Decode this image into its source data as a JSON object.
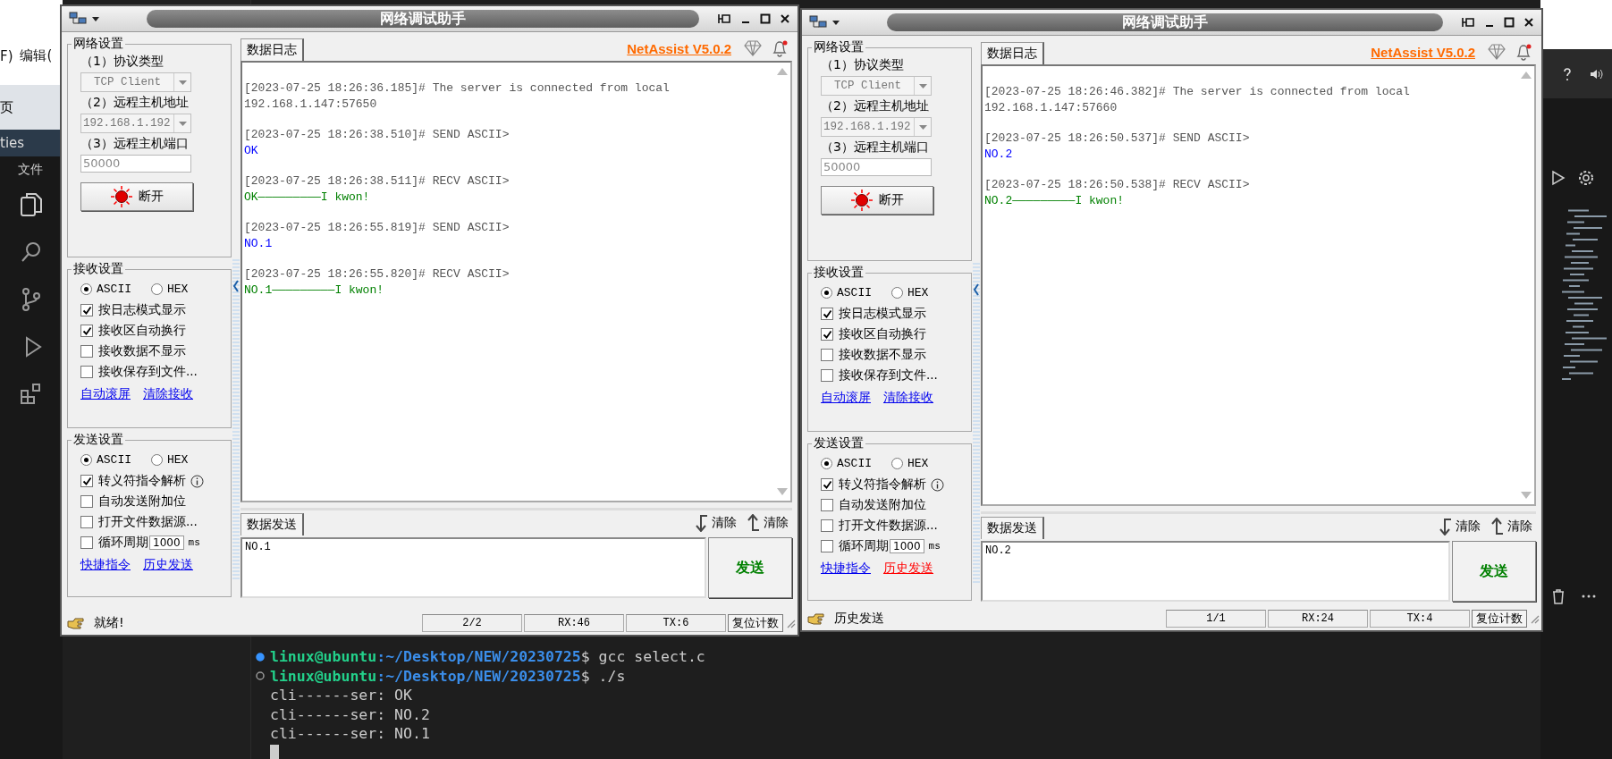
{
  "background": {
    "menu": [
      "F)",
      "编辑("
    ],
    "tab": "页",
    "explorer_title": "ties",
    "file_menu": "文件"
  },
  "windows": [
    {
      "title": "网络调试助手",
      "network_settings": {
        "title": "网络设置",
        "protocol_label": "（1）协议类型",
        "protocol": "TCP Client",
        "host_label": "（2）远程主机地址",
        "host": "192.168.1.192",
        "port_label": "（3）远程主机端口",
        "port": "50000",
        "connect_button": "断开",
        "connected": true
      },
      "receive_settings": {
        "title": "接收设置",
        "modes": [
          {
            "label": "ASCII",
            "selected": true
          },
          {
            "label": "HEX",
            "selected": false
          }
        ],
        "options": [
          {
            "kind": "plain",
            "label": "按日志模式显示",
            "checked": true
          },
          {
            "kind": "plain",
            "label": "接收区自动换行",
            "checked": true
          },
          {
            "kind": "plain",
            "label": "接收数据不显示",
            "checked": false
          },
          {
            "kind": "plain",
            "label": "接收保存到文件...",
            "checked": false
          }
        ],
        "links": [
          {
            "label": "自动滚屏",
            "highlighted": false
          },
          {
            "label": "清除接收",
            "highlighted": false
          }
        ]
      },
      "send_settings": {
        "title": "发送设置",
        "modes": [
          {
            "label": "ASCII",
            "selected": true
          },
          {
            "label": "HEX",
            "selected": false
          }
        ],
        "options": [
          {
            "kind": "info",
            "label": "转义符指令解析",
            "checked": true
          },
          {
            "kind": "plain",
            "label": "自动发送附加位",
            "checked": false
          },
          {
            "kind": "plain",
            "label": "打开文件数据源...",
            "checked": false
          },
          {
            "kind": "period",
            "label": "循环周期",
            "checked": false,
            "value": "1000",
            "unit": "ms"
          }
        ],
        "links": [
          {
            "label": "快捷指令",
            "highlighted": false
          },
          {
            "label": "历史发送",
            "highlighted": false
          }
        ]
      },
      "log_tab": "数据日志",
      "version": "NetAssist V5.0.2",
      "log": [
        {
          "kind": "info",
          "header": "[2023-07-25 18:26:36.185]# The server is connected from local",
          "body": "192.168.1.147:57650"
        },
        {
          "kind": "send",
          "header": "[2023-07-25 18:26:38.510]# SEND ASCII>",
          "body": "OK"
        },
        {
          "kind": "recv",
          "header": "[2023-07-25 18:26:38.511]# RECV ASCII>",
          "body": "OK—————————I kwon!"
        },
        {
          "kind": "send",
          "header": "[2023-07-25 18:26:55.819]# SEND ASCII>",
          "body": "NO.1"
        },
        {
          "kind": "recv",
          "header": "[2023-07-25 18:26:55.820]# RECV ASCII>",
          "body": "NO.1—————————I kwon!"
        }
      ],
      "send_tab": "数据发送",
      "clear_buttons": [
        "清除",
        "清除"
      ],
      "send_input": "NO.1",
      "send_button": "发送",
      "status": {
        "text": "就绪!",
        "cells": [
          "2/2",
          "RX:46",
          "TX:6"
        ],
        "reset_button": "复位计数"
      }
    },
    {
      "title": "网络调试助手",
      "network_settings": {
        "title": "网络设置",
        "protocol_label": "（1）协议类型",
        "protocol": "TCP Client",
        "host_label": "（2）远程主机地址",
        "host": "192.168.1.192",
        "port_label": "（3）远程主机端口",
        "port": "50000",
        "connect_button": "断开",
        "connected": true
      },
      "receive_settings": {
        "title": "接收设置",
        "modes": [
          {
            "label": "ASCII",
            "selected": true
          },
          {
            "label": "HEX",
            "selected": false
          }
        ],
        "options": [
          {
            "kind": "plain",
            "label": "按日志模式显示",
            "checked": true
          },
          {
            "kind": "plain",
            "label": "接收区自动换行",
            "checked": true
          },
          {
            "kind": "plain",
            "label": "接收数据不显示",
            "checked": false
          },
          {
            "kind": "plain",
            "label": "接收保存到文件...",
            "checked": false
          }
        ],
        "links": [
          {
            "label": "自动滚屏",
            "highlighted": false
          },
          {
            "label": "清除接收",
            "highlighted": false
          }
        ]
      },
      "send_settings": {
        "title": "发送设置",
        "modes": [
          {
            "label": "ASCII",
            "selected": true
          },
          {
            "label": "HEX",
            "selected": false
          }
        ],
        "options": [
          {
            "kind": "info",
            "label": "转义符指令解析",
            "checked": true
          },
          {
            "kind": "plain",
            "label": "自动发送附加位",
            "checked": false
          },
          {
            "kind": "plain",
            "label": "打开文件数据源...",
            "checked": false
          },
          {
            "kind": "period",
            "label": "循环周期",
            "checked": false,
            "value": "1000",
            "unit": "ms"
          }
        ],
        "links": [
          {
            "label": "快捷指令",
            "highlighted": false
          },
          {
            "label": "历史发送",
            "highlighted": true
          }
        ]
      },
      "log_tab": "数据日志",
      "version": "NetAssist V5.0.2",
      "log": [
        {
          "kind": "info",
          "header": "[2023-07-25 18:26:46.382]# The server is connected from local",
          "body": "192.168.1.147:57660"
        },
        {
          "kind": "send",
          "header": "[2023-07-25 18:26:50.537]# SEND ASCII>",
          "body": "NO.2"
        },
        {
          "kind": "recv",
          "header": "[2023-07-25 18:26:50.538]# RECV ASCII>",
          "body": "NO.2—————————I kwon!"
        }
      ],
      "send_tab": "数据发送",
      "clear_buttons": [
        "清除",
        "清除"
      ],
      "send_input": "NO.2",
      "send_button": "发送",
      "status": {
        "text": "历史发送",
        "cells": [
          "1/1",
          "RX:24",
          "TX:4"
        ],
        "reset_button": "复位计数"
      }
    }
  ],
  "terminal": {
    "lines": [
      {
        "kind": "prompt",
        "finished": true,
        "user": "linux@ubuntu",
        "path": ":~/Desktop/NEW/20230725",
        "command": "$ gcc select.c"
      },
      {
        "kind": "prompt",
        "finished": false,
        "user": "linux@ubuntu",
        "path": ":~/Desktop/NEW/20230725",
        "command": "$ ./s"
      },
      {
        "kind": "output",
        "text": "cli------ser: OK"
      },
      {
        "kind": "output",
        "text": "cli------ser: NO.2"
      },
      {
        "kind": "output",
        "text": "cli------ser: NO.1"
      },
      {
        "kind": "cursor"
      }
    ]
  }
}
